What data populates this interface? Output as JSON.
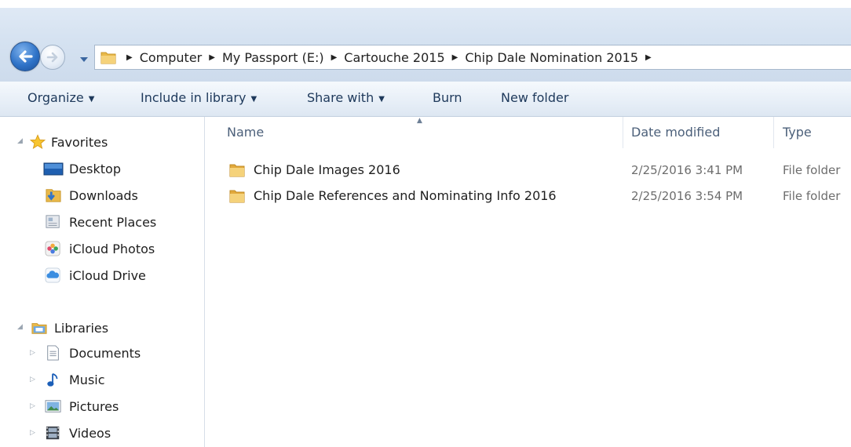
{
  "address": {
    "crumbs": [
      "Computer",
      "My Passport (E:)",
      "Cartouche 2015",
      "Chip Dale Nomination 2015"
    ]
  },
  "toolbar": {
    "organize": "Organize",
    "include_in_library": "Include in library",
    "share_with": "Share with",
    "burn": "Burn",
    "new_folder": "New folder"
  },
  "navpane": {
    "favorites": {
      "label": "Favorites",
      "items": [
        {
          "label": "Desktop",
          "icon": "desktop-icon"
        },
        {
          "label": "Downloads",
          "icon": "downloads-icon"
        },
        {
          "label": "Recent Places",
          "icon": "recent-places-icon"
        },
        {
          "label": "iCloud Photos",
          "icon": "icloud-photos-icon"
        },
        {
          "label": "iCloud Drive",
          "icon": "icloud-drive-icon"
        }
      ]
    },
    "libraries": {
      "label": "Libraries",
      "items": [
        {
          "label": "Documents",
          "icon": "documents-icon"
        },
        {
          "label": "Music",
          "icon": "music-icon"
        },
        {
          "label": "Pictures",
          "icon": "pictures-icon"
        },
        {
          "label": "Videos",
          "icon": "videos-icon"
        }
      ]
    }
  },
  "columns": {
    "name": "Name",
    "date_modified": "Date modified",
    "type": "Type"
  },
  "files": [
    {
      "name": "Chip Dale Images 2016",
      "date": "2/25/2016 3:41 PM",
      "type": "File folder"
    },
    {
      "name": "Chip Dale References and Nominating Info  2016",
      "date": "2/25/2016 3:54 PM",
      "type": "File folder"
    }
  ],
  "colors": {
    "toolbar_text": "#1e395b",
    "header_text": "#4c607a",
    "folder_yellow": "#e9b94a",
    "accent_blue": "#2f73c8"
  }
}
